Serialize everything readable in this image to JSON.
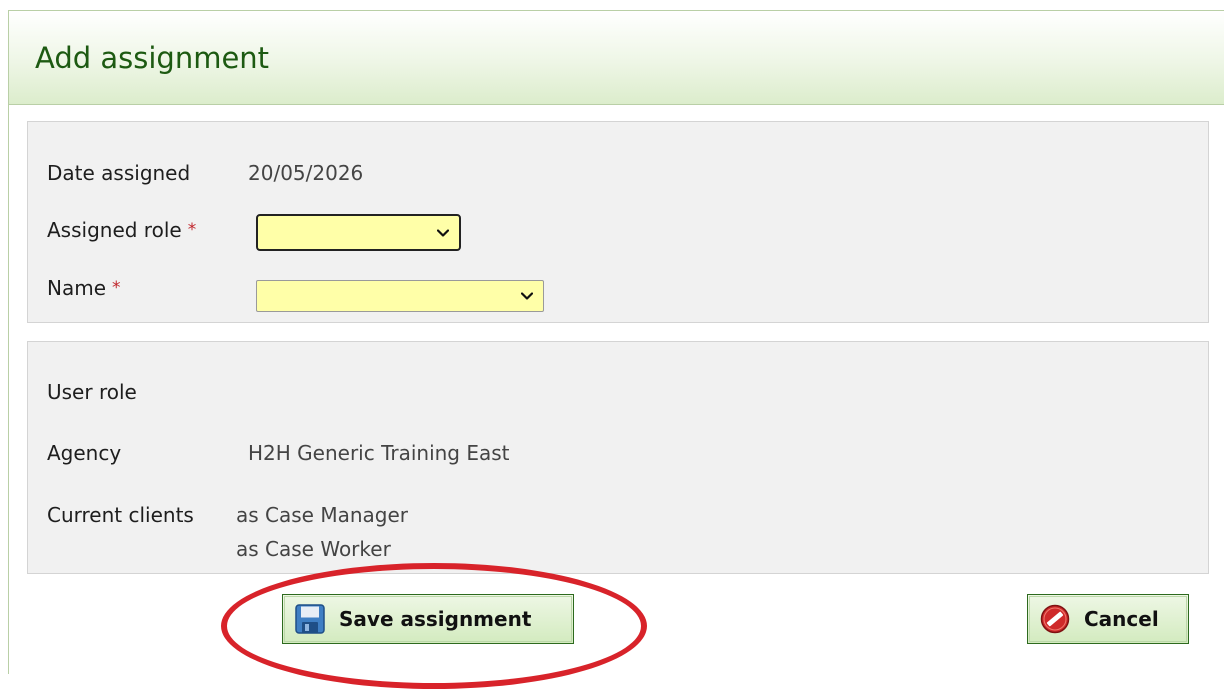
{
  "dialog": {
    "title": "Add assignment"
  },
  "assignment_form": {
    "date_assigned_label": "Date assigned",
    "date_assigned_value": "20/05/2026",
    "assigned_role_label": "Assigned role",
    "assigned_role_value": "",
    "name_label": "Name",
    "name_value": "",
    "required_marker": "*",
    "required_field_color": "#ffffa8"
  },
  "user_info": {
    "user_role_label": "User role",
    "agency_label": "Agency",
    "agency_value": "H2H Generic Training East",
    "current_clients_label": "Current clients",
    "current_clients": [
      "as Case Manager",
      "as Case Worker"
    ]
  },
  "actions": {
    "save_label": "Save assignment",
    "save_icon": "floppy-disk-icon",
    "cancel_label": "Cancel",
    "cancel_icon": "no-entry-icon"
  },
  "annotation": {
    "highlight_color": "#d8232a"
  }
}
